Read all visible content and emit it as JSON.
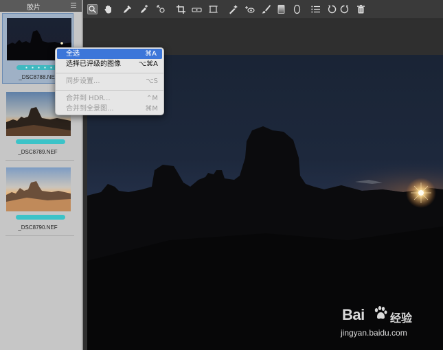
{
  "filmstrip": {
    "title": "胶片",
    "items": [
      {
        "filename": "_DSC8788.NEF",
        "selected": true,
        "rating_dots": 5
      },
      {
        "filename": "_DSC8789.NEF",
        "selected": false
      },
      {
        "filename": "_DSC8790.NEF",
        "selected": false
      }
    ]
  },
  "toolbar": {
    "tools": [
      "zoom-icon",
      "hand-icon",
      "eyedropper-icon",
      "color-sampler-icon",
      "target-adjust-icon",
      "crop-icon",
      "straighten-icon",
      "transform-icon",
      "spot-removal-icon",
      "red-eye-icon",
      "brush-icon",
      "graduated-filter-icon",
      "radial-filter-icon",
      "list-icon",
      "rotate-left-icon",
      "rotate-right-icon",
      "trash-icon"
    ]
  },
  "context_menu": {
    "items": [
      {
        "label": "全选",
        "shortcut": "⌘A",
        "state": "highlighted"
      },
      {
        "label": "选择已评级的图像",
        "shortcut": "⌥⌘A",
        "state": "enabled"
      },
      {
        "label": "同步设置...",
        "shortcut": "⌥S",
        "state": "disabled"
      },
      {
        "label": "合并到 HDR...",
        "shortcut": "⌃M",
        "state": "disabled"
      },
      {
        "label": "合并到全景图...",
        "shortcut": "⌘M",
        "state": "disabled"
      }
    ]
  },
  "watermark": {
    "brand": "Bai",
    "brand_cn": "经验",
    "url": "jingyan.baidu.com"
  },
  "colors": {
    "accent_highlight": "#3c76d9",
    "rating_bar": "#3cc3c8",
    "panel_bg": "#c6c6c6",
    "toolbar_bg": "#3a3a3a"
  }
}
